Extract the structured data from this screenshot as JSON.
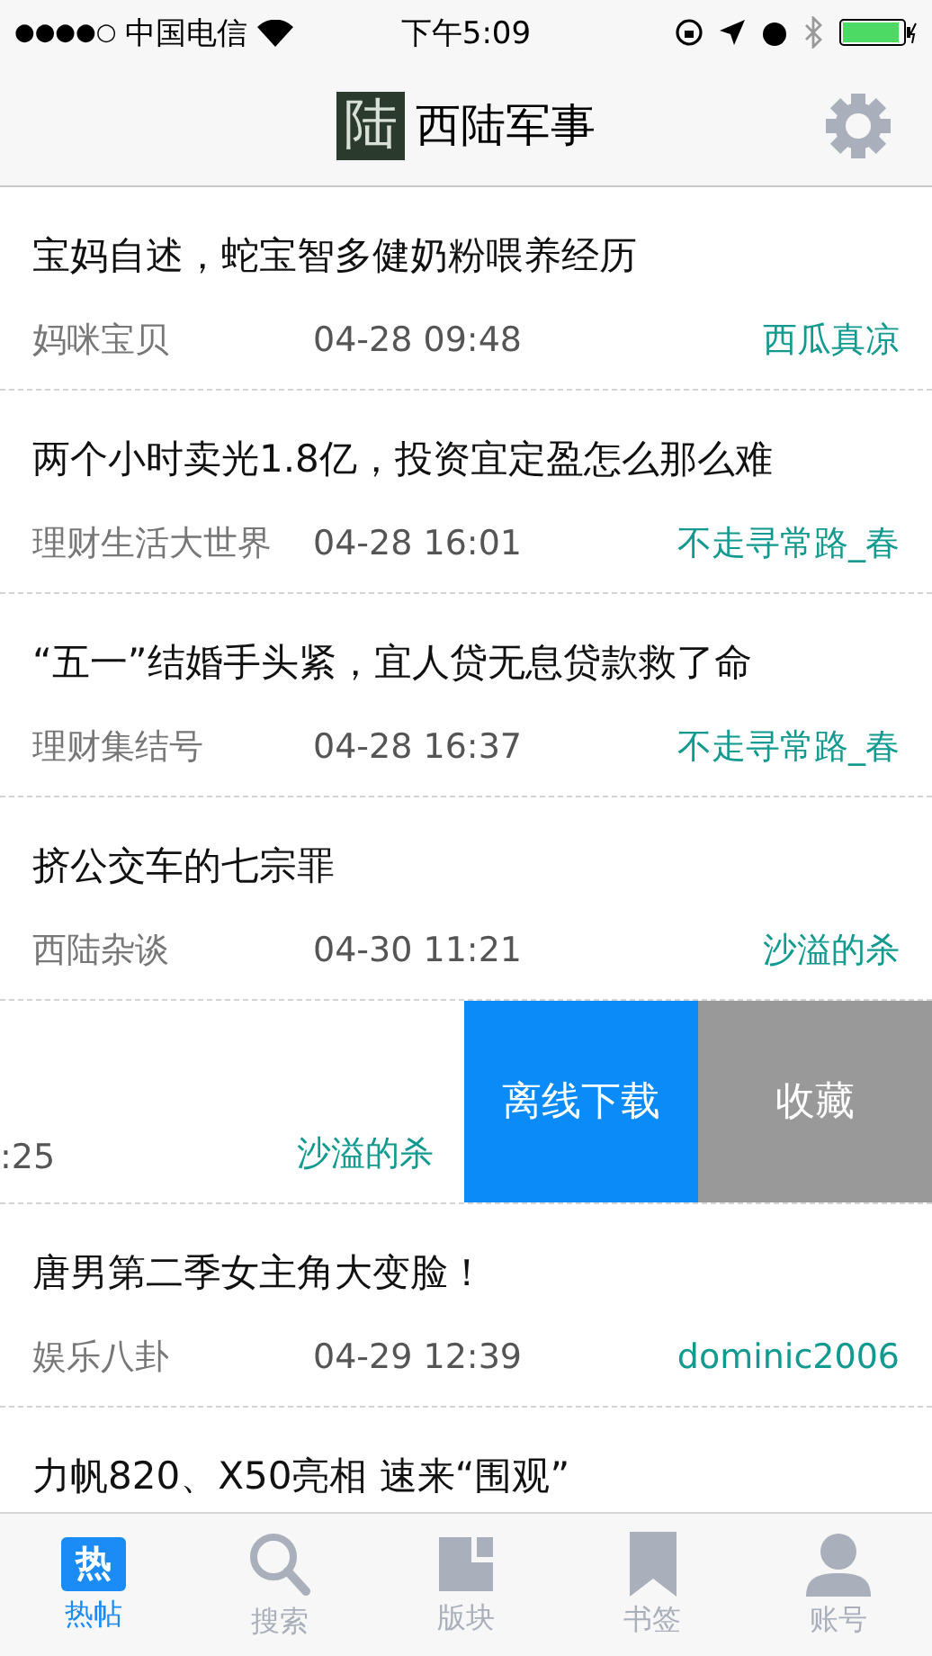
{
  "status_bar": {
    "signal_bars": "●●●●○",
    "carrier": "中国电信",
    "time": "下午5:09"
  },
  "nav": {
    "logo_text": "陆",
    "title": "西陆军事"
  },
  "rows": [
    {
      "kind": "article",
      "title": "宝妈自述，蛇宝智多健奶粉喂养经历",
      "source": "妈咪宝贝",
      "time": "04-28 09:48",
      "author": "西瓜真凉"
    },
    {
      "kind": "article",
      "title": "两个小时卖光1.8亿，投资宜定盈怎么那么难",
      "source": "理财生活大世界",
      "time": "04-28 16:01",
      "author": "不走寻常路_春"
    },
    {
      "kind": "article",
      "title": "“五一”结婚手头紧，宜人贷无息贷款救了命",
      "source": "理财集结号",
      "time": "04-28 16:37",
      "author": "不走寻常路_春"
    },
    {
      "kind": "article",
      "title": "挤公交车的七宗罪",
      "source": "西陆杂谈",
      "time": "04-30 11:21",
      "author": "沙溢的杀"
    },
    {
      "kind": "swiped",
      "time": ":25",
      "author": "沙溢的杀",
      "actions": [
        {
          "label": "离线下载",
          "kind": "download"
        },
        {
          "label": "收藏",
          "kind": "favorite"
        }
      ]
    },
    {
      "kind": "article",
      "title": "唐男第二季女主角大变脸！",
      "source": "娱乐八卦",
      "time": "04-29 12:39",
      "author": "dominic2006"
    },
    {
      "kind": "partial",
      "title": "力帆820、X50亮相 速来“围观”"
    }
  ],
  "tabs": [
    {
      "label": "热帖",
      "kind": "hot",
      "icon_text": "热",
      "selected": true
    },
    {
      "label": "搜索",
      "kind": "search",
      "selected": false
    },
    {
      "label": "版块",
      "kind": "board",
      "selected": false
    },
    {
      "label": "书签",
      "kind": "bookmark",
      "selected": false
    },
    {
      "label": "账号",
      "kind": "account",
      "selected": false
    }
  ]
}
